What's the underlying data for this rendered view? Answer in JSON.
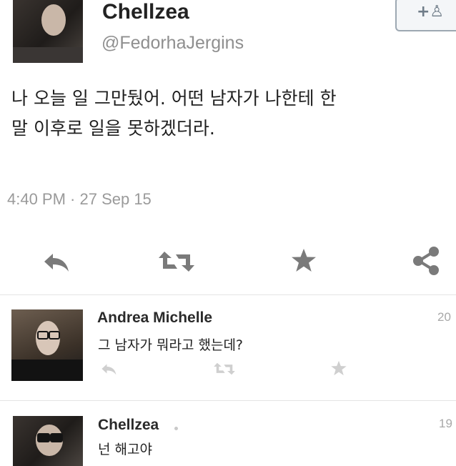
{
  "tweet": {
    "display_name": "Chellzea",
    "handle": "@FedorhaJergins",
    "text_line1": "나 오늘 일 그만뒀어. 어떤 남자가 나한테 한",
    "text_line2": "말 이후로 일을 못하겠더라.",
    "timestamp": "4:40 PM · 27 Sep 15",
    "follow_icon": "follow-plus-person-icon",
    "actions": [
      "reply-icon",
      "retweet-icon",
      "favorite-star-icon",
      "share-icon"
    ]
  },
  "replies": [
    {
      "display_name": "Andrea Michelle",
      "text": "그 남자가 뭐라고 했는데?",
      "time": "20",
      "actions": [
        "reply-icon",
        "retweet-icon",
        "favorite-star-icon"
      ]
    },
    {
      "display_name": "Chellzea",
      "text": "넌 해고야",
      "time": "19"
    }
  ],
  "colors": {
    "text": "#1f1f1f",
    "muted": "#9a9a9a",
    "icon": "#7d7d7d",
    "divider": "#e4e4e4"
  }
}
